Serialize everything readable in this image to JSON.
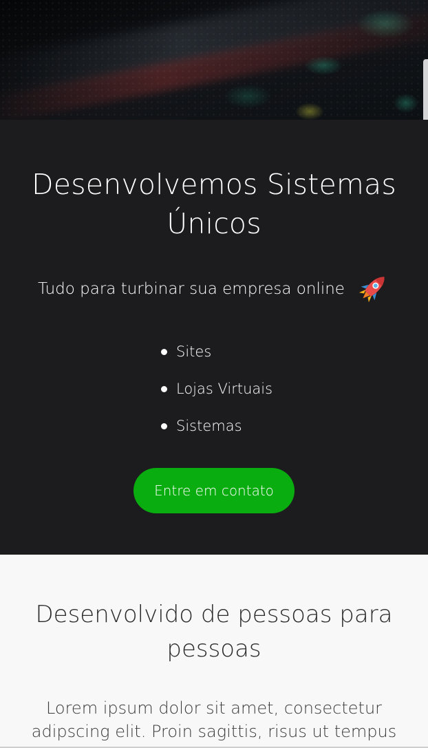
{
  "hero": {
    "title": "Desenvolvemos Sistemas Únicos",
    "tagline": "Tudo para turbinar sua empresa online",
    "tagline_icon": "rocket-icon",
    "services": [
      "Sites",
      "Lojas Virtuais",
      "Sistemas"
    ],
    "cta_label": "Entre em contato",
    "cta_color": "#0aad0f",
    "background_color": "#1c1c1f"
  },
  "about": {
    "title": "Desenvolvido de pessoas para pessoas",
    "text": "Lorem ipsum dolor sit amet, consectetur adipscing elit. Proin sagittis, risus ut tempus condimentum",
    "background_color": "#f8f8f8"
  }
}
